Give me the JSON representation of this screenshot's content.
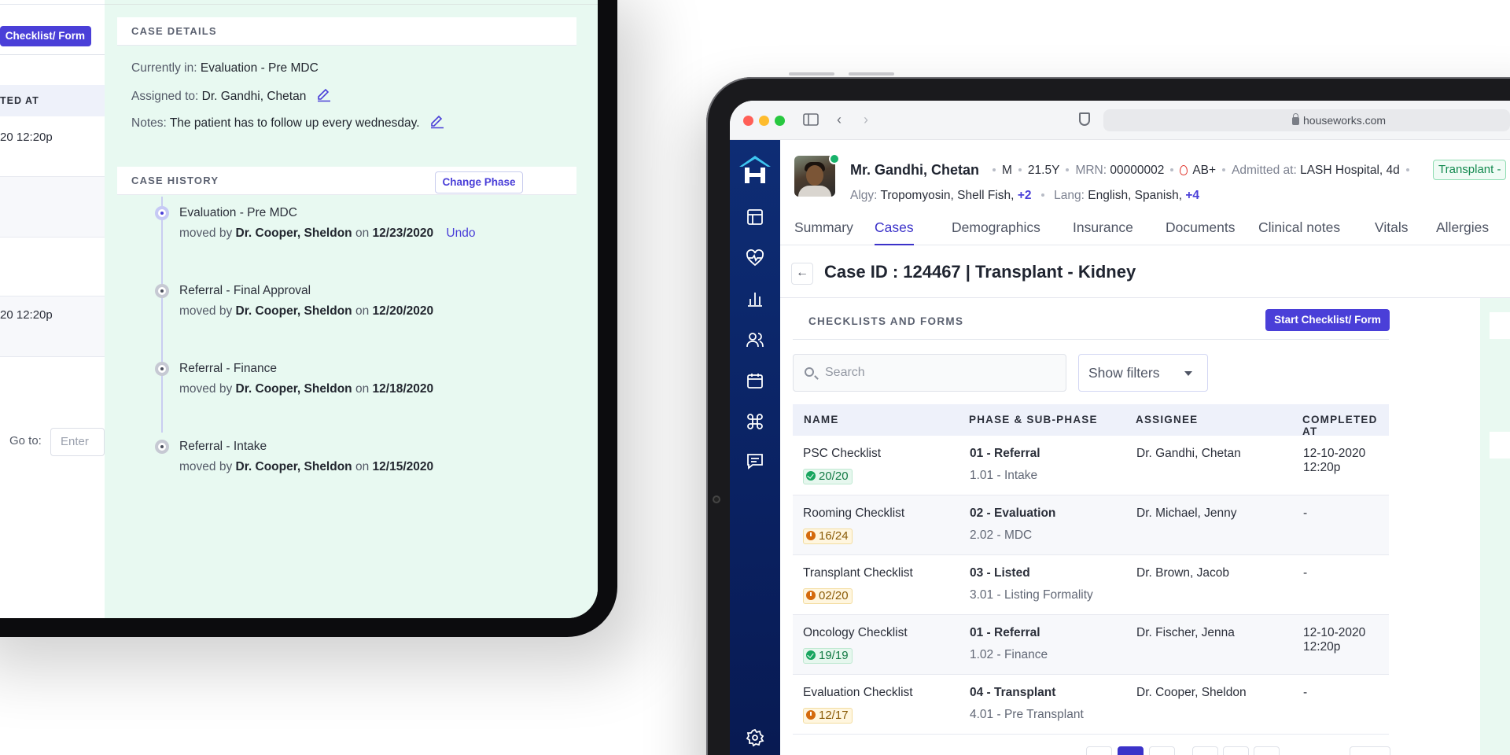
{
  "left_panel": {
    "start_button_label": "Checklist/ Form",
    "table_header_fragment": "TED AT",
    "row_values": [
      "20 12:20p",
      "20 12:20p"
    ],
    "goto_label": "Go to:",
    "goto_placeholder": "Enter",
    "case_details": {
      "header": "CASE DETAILS",
      "currently_in_label": "Currently in:",
      "currently_in_value": "Evaluation - Pre MDC",
      "assigned_label": "Assigned to:",
      "assigned_value": "Dr. Gandhi, Chetan",
      "notes_label": "Notes:",
      "notes_value": "The patient has to follow up every wednesday."
    },
    "case_history": {
      "header": "CASE HISTORY",
      "change_phase_label": "Change Phase",
      "moved_by_label": "moved by",
      "on_label": "on",
      "undo_label": "Undo",
      "events": [
        {
          "title": "Evaluation - Pre MDC",
          "by": "Dr. Cooper, Sheldon",
          "date": "12/23/2020"
        },
        {
          "title": "Referral - Final Approval",
          "by": "Dr. Cooper, Sheldon",
          "date": "12/20/2020"
        },
        {
          "title": "Referral - Finance",
          "by": "Dr. Cooper, Sheldon",
          "date": "12/18/2020"
        },
        {
          "title": "Referral - Intake",
          "by": "Dr. Cooper, Sheldon",
          "date": "12/15/2020"
        }
      ]
    }
  },
  "browser": {
    "url": "houseworks.com"
  },
  "sidebar_icons": [
    "home-logo-icon",
    "layout-icon",
    "heart-pulse-icon",
    "bar-chart-icon",
    "users-icon",
    "calendar-icon",
    "command-icon",
    "message-icon",
    "settings-icon"
  ],
  "patient": {
    "name": "Mr. Gandhi, Chetan",
    "sex": "M",
    "age": "21.5Y",
    "mrn_label": "MRN:",
    "mrn": "00000002",
    "blood": "AB+",
    "admitted_label": "Admitted at:",
    "admitted": "LASH Hospital, 4d",
    "tag": "Transplant -",
    "algy_label": "Algy:",
    "algy": "Tropomyosin, Shell Fish,",
    "algy_more": "+2",
    "lang_label": "Lang:",
    "lang": "English, Spanish,",
    "lang_more": "+4"
  },
  "tabs": [
    "Summary",
    "Cases",
    "Demographics",
    "Insurance",
    "Documents",
    "Clinical notes",
    "Vitals",
    "Allergies"
  ],
  "active_tab": "Cases",
  "case_title": "Case ID : 124467 | Transplant - Kidney",
  "checklists": {
    "header": "CHECKLISTS AND FORMS",
    "start_label": "Start Checklist/ Form",
    "search_placeholder": "Search",
    "filters_label": "Show filters",
    "columns": [
      "NAME",
      "PHASE & SUB-PHASE",
      "ASSIGNEE",
      "COMPLETED AT"
    ],
    "rows": [
      {
        "name": "PSC Checklist",
        "progress": "20/20",
        "status": "ok",
        "phase": "01 - Referral",
        "subphase": "1.01 - Intake",
        "assignee": "Dr. Gandhi, Chetan",
        "completed": "12-10-2020 12:20p"
      },
      {
        "name": "Rooming Checklist",
        "progress": "16/24",
        "status": "warn",
        "phase": "02 - Evaluation",
        "subphase": "2.02 - MDC",
        "assignee": "Dr. Michael, Jenny",
        "completed": "-"
      },
      {
        "name": "Transplant Checklist",
        "progress": "02/20",
        "status": "warn",
        "phase": "03 - Listed",
        "subphase": "3.01 - Listing Formality",
        "assignee": "Dr. Brown, Jacob",
        "completed": "-"
      },
      {
        "name": "Oncology Checklist",
        "progress": "19/19",
        "status": "ok",
        "phase": "01 - Referral",
        "subphase": "1.02 - Finance",
        "assignee": "Dr. Fischer, Jenna",
        "completed": "12-10-2020 12:20p"
      },
      {
        "name": "Evaluation Checklist",
        "progress": "12/17",
        "status": "warn",
        "phase": "04 - Transplant",
        "subphase": "4.01 - Pre Transplant",
        "assignee": "Dr. Cooper, Sheldon",
        "completed": "-"
      }
    ]
  }
}
